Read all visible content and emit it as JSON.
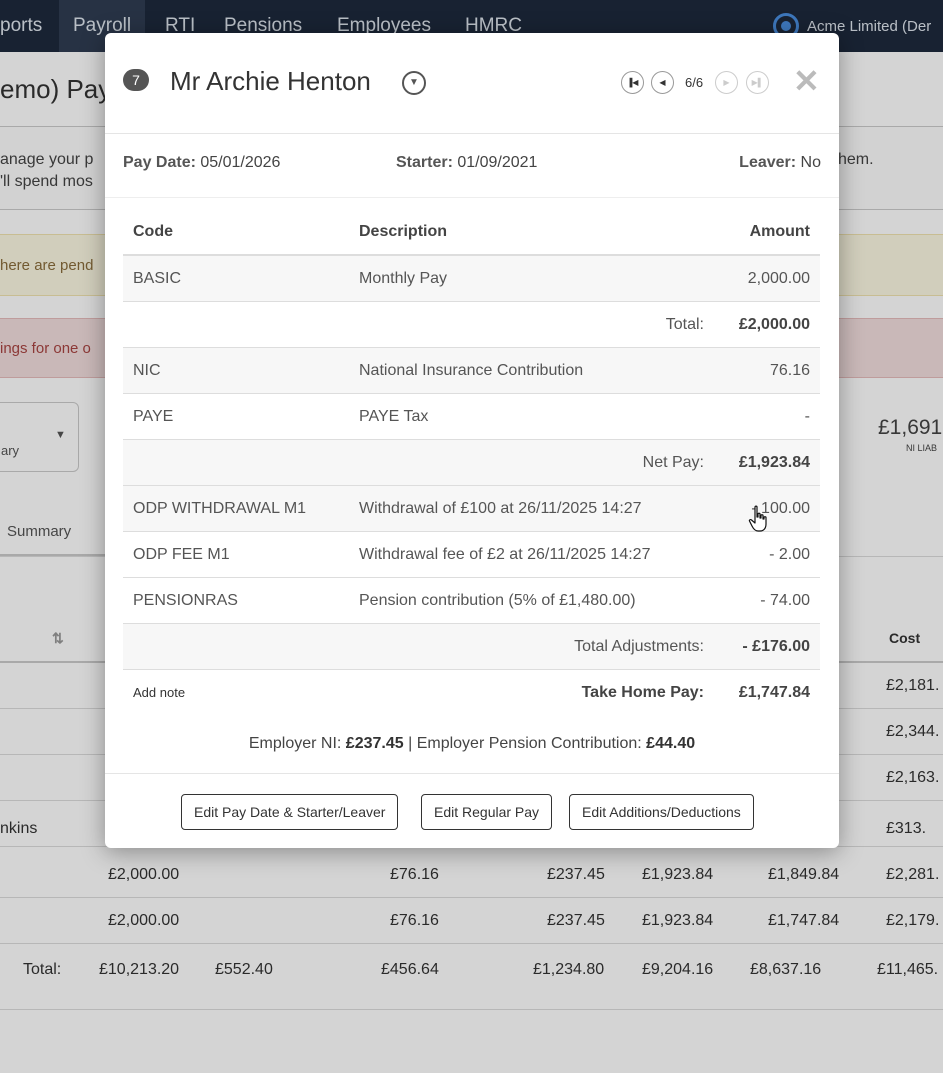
{
  "navbar": {
    "items": [
      "ports",
      "Payroll",
      "RTI",
      "Pensions",
      "Employees",
      "HMRC"
    ],
    "active_index": 1,
    "company": "Acme Limited (Der"
  },
  "background": {
    "title": "emo) Pay",
    "intro_line1": "anage your p",
    "intro_line1_end": "hem.",
    "intro_line2": "'ll spend mos",
    "alert_pending": "here are pend",
    "alert_warnings": "ings for one o",
    "select_text": "ary",
    "liability_value": "£1,691",
    "liability_label": "NI LIAB",
    "tab_summary": "Summary",
    "table_header_cost": "Cost",
    "table_rows": [
      {
        "name": "",
        "cost": "£2,181."
      },
      {
        "name": "",
        "cost": "£2,344."
      },
      {
        "name": "",
        "cost": "£2,163."
      },
      {
        "name": "nkins",
        "cost": "£313."
      },
      {
        "name": "",
        "gross": "£2,000.00",
        "ni": "£76.16",
        "er_ni": "£237.45",
        "net": "£1,923.84",
        "take_home": "£1,849.84",
        "cost": "£2,281."
      },
      {
        "name": "",
        "gross": "£2,000.00",
        "ni": "£76.16",
        "er_ni": "£237.45",
        "net": "£1,923.84",
        "take_home": "£1,747.84",
        "cost": "£2,179."
      }
    ],
    "totals": {
      "label": "Total:",
      "gross": "£10,213.20",
      "col2": "£552.40",
      "ni": "£456.64",
      "er_ni": "£1,234.80",
      "net": "£9,204.16",
      "take_home": "£8,637.16",
      "cost": "£11,465."
    }
  },
  "modal": {
    "badge": "7",
    "employee_name": "Mr Archie Henton",
    "page_counter": "6/6",
    "close_symbol": "✕",
    "pay_date_label": "Pay Date:",
    "pay_date": "05/01/2026",
    "starter_label": "Starter:",
    "starter": "01/09/2021",
    "leaver_label": "Leaver:",
    "leaver": "No",
    "table": {
      "headers": {
        "code": "Code",
        "description": "Description",
        "amount": "Amount"
      },
      "basic": {
        "code": "BASIC",
        "description": "Monthly Pay",
        "amount": "2,000.00"
      },
      "total": {
        "label": "Total:",
        "amount": "£2,000.00"
      },
      "nic": {
        "code": "NIC",
        "description": "National Insurance Contribution",
        "amount": "76.16"
      },
      "paye": {
        "code": "PAYE",
        "description": "PAYE Tax",
        "amount": "-"
      },
      "net_pay": {
        "label": "Net Pay:",
        "amount": "£1,923.84"
      },
      "odp_withdrawal": {
        "code": "ODP WITHDRAWAL M1",
        "description": "Withdrawal of £100 at 26/11/2025 14:27",
        "amount": "- 100.00"
      },
      "odp_fee": {
        "code": "ODP FEE M1",
        "description": "Withdrawal fee of £2 at 26/11/2025 14:27",
        "amount": "- 2.00"
      },
      "pension": {
        "code": "PENSIONRAS",
        "description": "Pension contribution (5% of £1,480.00)",
        "amount": "- 74.00"
      },
      "total_adjustments": {
        "label": "Total Adjustments:",
        "amount": "- £176.00"
      },
      "take_home": {
        "note": "Add note",
        "label": "Take Home Pay:",
        "amount": "£1,747.84"
      }
    },
    "employer_ni_label": "Employer NI:",
    "employer_ni": "£237.45",
    "separator": "|",
    "employer_pension_label": "Employer Pension Contribution:",
    "employer_pension": "£44.40",
    "buttons": {
      "edit_dates": "Edit Pay Date & Starter/Leaver",
      "edit_regular": "Edit Regular Pay",
      "edit_additions": "Edit Additions/Deductions"
    }
  }
}
